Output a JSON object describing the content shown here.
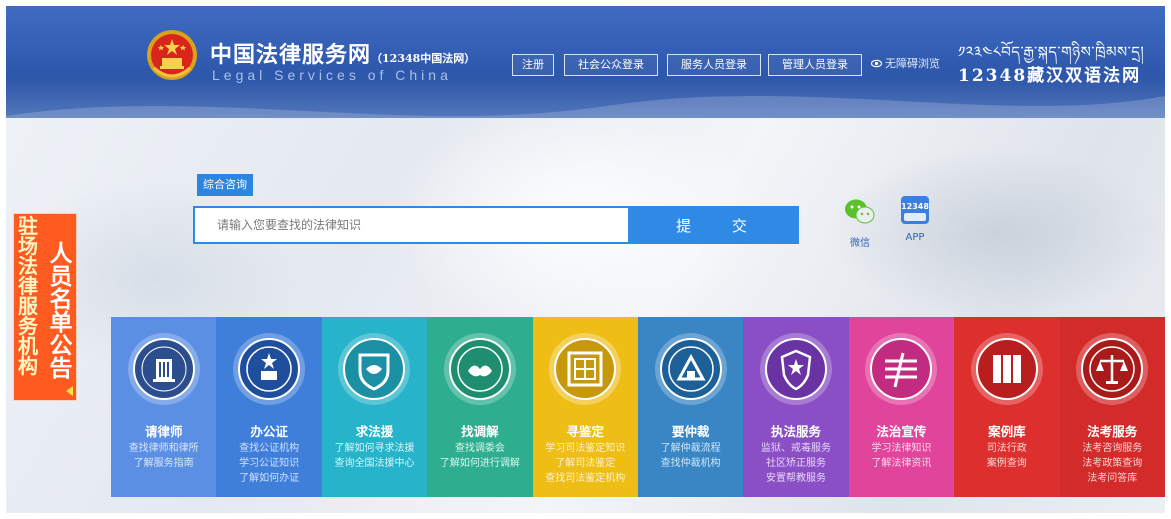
{
  "header": {
    "site_name": "中国法律服务网",
    "site_sub": "（12348中国法网）",
    "site_en": "Legal Services of China",
    "buttons": [
      "注册",
      "社会公众登录",
      "服务人员登录",
      "管理人员登录"
    ],
    "accessibility_label": "无障碍浏览",
    "tibetan_line": "༡༢༣༤༨བོད་རྒྱ་སྐད་གཉིས་ཁྲིམས་དྲ།",
    "hotline_label": "12348藏汉双语法网"
  },
  "search": {
    "tab_label": "综合咨询",
    "placeholder": "请输入您要查找的法律知识",
    "submit_label": "提 交"
  },
  "social": {
    "wechat_label": "微信",
    "app_label": "APP",
    "app_icon_text": "12348"
  },
  "notice": {
    "col1": "驻场法律服务机构",
    "col2": "人员名单公告"
  },
  "tiles": [
    {
      "title": "请律师",
      "lines": [
        "查找律师和律所",
        "了解服务指南"
      ],
      "icon": "lawyer-emblem-icon",
      "bg": "#5b8fe3",
      "sub": "#dbe7ff"
    },
    {
      "title": "办公证",
      "lines": [
        "查找公证机构",
        "学习公证知识",
        "了解如何办证"
      ],
      "icon": "notary-emblem-icon",
      "bg": "#3f7fd9",
      "sub": "#cfe0ff"
    },
    {
      "title": "求法援",
      "lines": [
        "了解如何寻求法援",
        "查询全国法援中心"
      ],
      "icon": "legal-aid-icon",
      "bg": "#27b3c9",
      "sub": "#d4f6fb"
    },
    {
      "title": "找调解",
      "lines": [
        "查找调委会",
        "了解如何进行调解"
      ],
      "icon": "mediation-icon",
      "bg": "#2fae8f",
      "sub": "#d6f7ec"
    },
    {
      "title": "寻鉴定",
      "lines": [
        "学习司法鉴定知识",
        "了解司法鉴定",
        "查找司法鉴定机构"
      ],
      "icon": "appraisal-icon",
      "bg": "#eebd16",
      "sub": "#fff3c9"
    },
    {
      "title": "要仲裁",
      "lines": [
        "了解仲裁流程",
        "查找仲裁机构"
      ],
      "icon": "arbitration-icon",
      "bg": "#3a86c4",
      "sub": "#cfe6fa"
    },
    {
      "title": "执法服务",
      "lines": [
        "监狱、戒毒服务",
        "社区矫正服务",
        "安置帮教服务"
      ],
      "icon": "police-emblem-icon",
      "bg": "#8a4fc5",
      "sub": "#e8d7fa"
    },
    {
      "title": "法治宣传",
      "lines": [
        "学习法律知识",
        "了解法律资讯"
      ],
      "icon": "publicity-icon",
      "bg": "#e0449b",
      "sub": "#ffd9ee"
    },
    {
      "title": "案例库",
      "lines": [
        "司法行政",
        "案例查询"
      ],
      "icon": "case-library-icon",
      "bg": "#de2f2f",
      "sub": "#ffd7d7"
    },
    {
      "title": "法考服务",
      "lines": [
        "法考咨询服务",
        "法考政策查询",
        "法考问答库"
      ],
      "icon": "exam-scales-icon",
      "bg": "#d32a2a",
      "sub": "#ffd3d3"
    }
  ]
}
